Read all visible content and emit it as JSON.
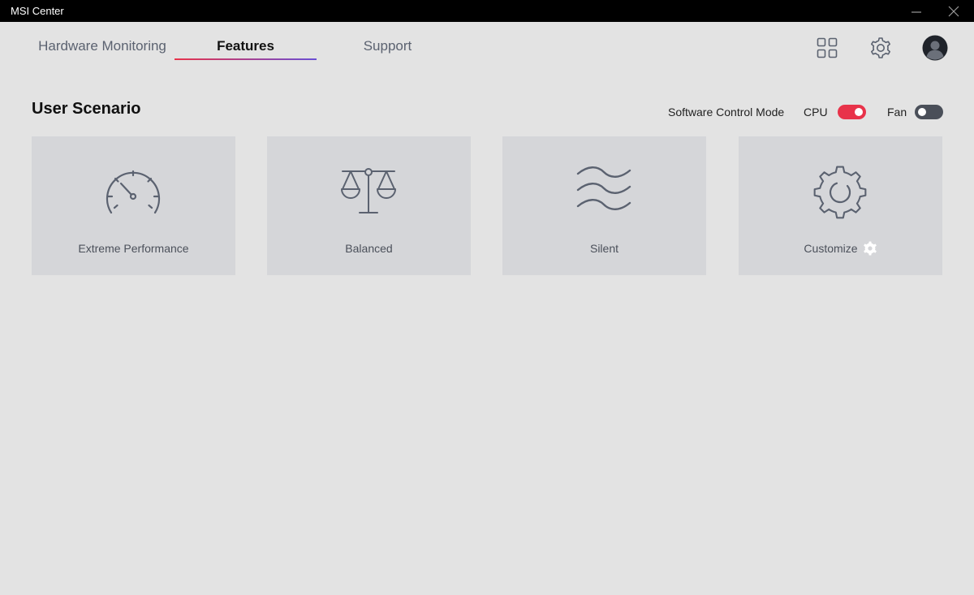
{
  "window": {
    "title": "MSI Center"
  },
  "tabs": [
    {
      "label": "Hardware Monitoring",
      "active": false
    },
    {
      "label": "Features",
      "active": true
    },
    {
      "label": "Support",
      "active": false
    }
  ],
  "header_icons": [
    "apps-grid-icon",
    "settings-gear-icon",
    "user-avatar-icon"
  ],
  "section": {
    "title": "User Scenario",
    "software_control_mode_label": "Software Control Mode",
    "cpu_label": "CPU",
    "cpu_toggle_on": true,
    "fan_label": "Fan",
    "fan_toggle_on": false
  },
  "scenarios": [
    {
      "label": "Extreme Performance",
      "icon": "speedometer-icon"
    },
    {
      "label": "Balanced",
      "icon": "balance-scale-icon"
    },
    {
      "label": "Silent",
      "icon": "waves-icon"
    },
    {
      "label": "Customize",
      "icon": "gear-icon"
    }
  ],
  "colors": {
    "accent_red": "#e8334a",
    "accent_purple": "#6a4fd4",
    "card_bg": "#d5d6d9",
    "background": "#e3e3e3",
    "icon_gray": "#5b6270"
  }
}
